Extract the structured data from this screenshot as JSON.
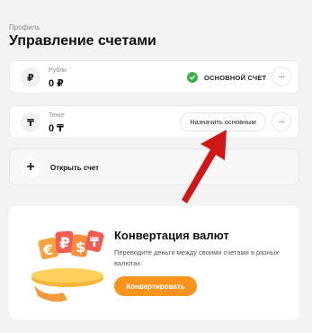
{
  "header": {
    "breadcrumb": "Профиль",
    "title": "Управление счетами"
  },
  "accounts": [
    {
      "symbol": "₽",
      "name": "Рубли",
      "balance": "0 ₽",
      "main_label": "ОСНОВНОЙ СЧЕТ",
      "more": "···"
    },
    {
      "symbol": "₸",
      "name": "Тенге",
      "balance": "0 ₸",
      "make_main_label": "Назначить основным",
      "more": "···"
    }
  ],
  "open_account": {
    "plus": "+",
    "label": "Открыть счет"
  },
  "conversion": {
    "title": "Конвертация валют",
    "description": "Переводите деньги между своими счетами в разных валютах.",
    "button_label": "Конвертировать",
    "illustration_symbols": [
      "€",
      "₽",
      "$",
      "₸"
    ]
  },
  "colors": {
    "accent": "#f7941d",
    "success": "#3fae4a",
    "arrow": "#d01616"
  }
}
